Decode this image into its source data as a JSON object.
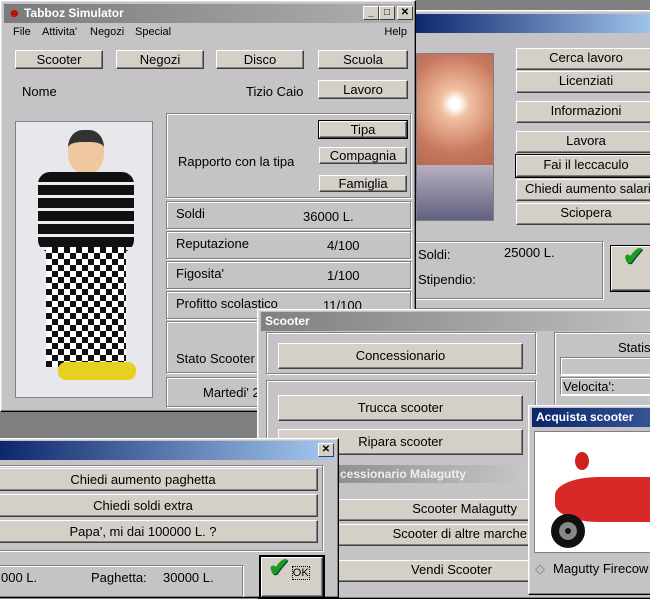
{
  "work_window": {
    "buttons": [
      "Cerca lavoro",
      "Licenziati",
      "Informazioni",
      "Lavora",
      "Fai il leccaculo",
      "Chiedi aumento salari",
      "Sciopera"
    ],
    "soldi_label": "Soldi:",
    "soldi_value": "25000 L.",
    "stipendio_label": "Stipendio:"
  },
  "main_window": {
    "title": "Tabboz Simulator",
    "menu": [
      "File",
      "Attivita'",
      "Negozi",
      "Special",
      "Help"
    ],
    "nav_buttons": [
      "Scooter",
      "Negozi",
      "Disco",
      "Scuola",
      "Lavoro"
    ],
    "nome_label": "Nome",
    "nome_value": "Tizio Caio",
    "rapporto_label": "Rapporto con la tipa",
    "rel_buttons": [
      "Tipa",
      "Compagnia",
      "Famiglia"
    ],
    "stats": [
      {
        "label": "Soldi",
        "value": "36000 L."
      },
      {
        "label": "Reputazione",
        "value": "4/100"
      },
      {
        "label": "Figosita'",
        "value": "1/100"
      },
      {
        "label": "Profitto scolastico",
        "value": "11/100"
      }
    ],
    "stato_scooter_label": "Stato Scooter",
    "date": "Martedi' 2"
  },
  "scooter_window": {
    "title": "Scooter",
    "concessionario": "Concessionario",
    "trucca": "Trucca scooter",
    "ripara": "Ripara scooter",
    "subtitle": "cessionario Malagutty",
    "malagutty": "Scooter Malagutty",
    "altre": "Scooter di altre marche",
    "vendi": "Vendi Scooter",
    "stats_title": "Statis",
    "velocita_label": "Velocita':"
  },
  "family_window": {
    "buttons": [
      "Chiedi aumento paghetta",
      "Chiedi soldi extra",
      "Papa', mi dai 100000 L. ?"
    ],
    "soldi_value": "000 L.",
    "paghetta_label": "Paghetta:",
    "paghetta_value": "30000 L.",
    "ok": "OK"
  },
  "acquista_window": {
    "title": "Acquista scooter",
    "model": "Magutty Firecow"
  }
}
